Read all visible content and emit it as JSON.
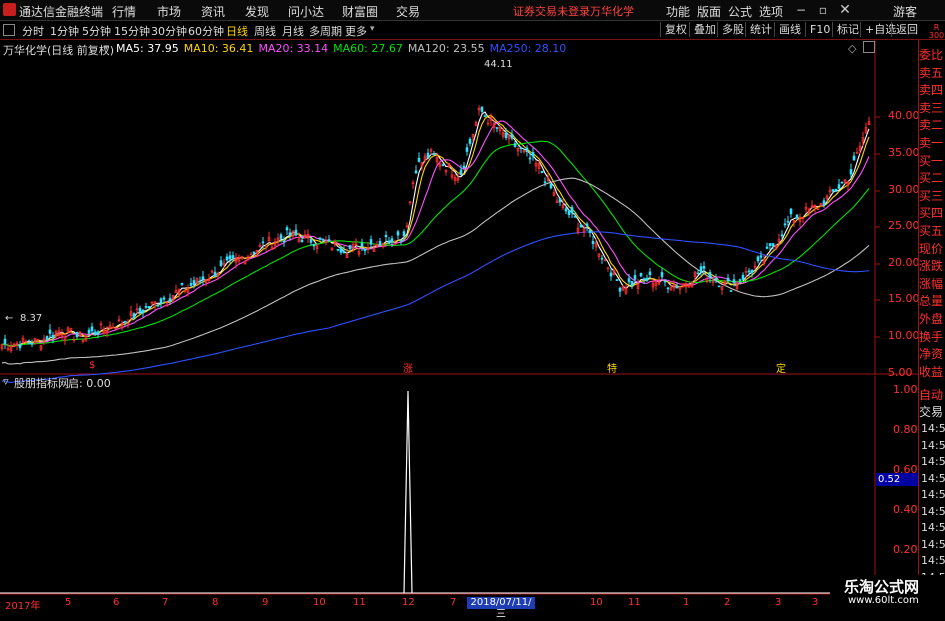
{
  "menubar": {
    "app_title": "通达信金融终端",
    "items": [
      "行情",
      "市场",
      "资讯",
      "发现",
      "问小达",
      "财富圈",
      "交易"
    ],
    "warning": "证券交易未登录",
    "stock": "万华化学",
    "right_items": [
      "功能",
      "版面",
      "公式",
      "选项"
    ],
    "user": "游客"
  },
  "toolbar": {
    "tabs": [
      "分时",
      "1分钟",
      "5分钟",
      "15分钟",
      "30分钟",
      "60分钟",
      "日线",
      "周线",
      "月线",
      "多周期",
      "更多"
    ],
    "active_tab": "日线",
    "right_buttons": [
      "复权",
      "叠加",
      "多股",
      "统计",
      "画线",
      "F10",
      "标记",
      "+自选",
      "返回"
    ]
  },
  "main_chart": {
    "title": "万华化学(日线 前复权)",
    "ma_labels": [
      {
        "text": "MA5: 37.95",
        "color": "#ffffff"
      },
      {
        "text": "MA10: 36.41",
        "color": "#ffd700"
      },
      {
        "text": "MA20: 33.14",
        "color": "#ff4fff"
      },
      {
        "text": "MA60: 27.67",
        "color": "#00e000"
      },
      {
        "text": "MA120: 23.55",
        "color": "#c0c0c0"
      },
      {
        "text": "MA250: 28.10",
        "color": "#3050ff"
      }
    ],
    "high_label": "44.11",
    "low_label": "8.37",
    "y_ticks": [
      "40.00",
      "35.00",
      "30.00",
      "25.00",
      "20.00",
      "15.00",
      "10.00",
      "5.00"
    ],
    "marks": [
      {
        "text": "$",
        "color": "#ff3030"
      },
      {
        "text": "涨",
        "color": "#ff3030"
      },
      {
        "text": "特",
        "color": "#ffd700"
      },
      {
        "text": "定",
        "color": "#ffd700"
      }
    ]
  },
  "side_panel": {
    "top_badge": "R 300",
    "labels": [
      "委比",
      "卖五",
      "卖四",
      "卖三",
      "卖二",
      "卖一",
      "买一",
      "买二",
      "买三",
      "买四",
      "买五",
      "现价",
      "涨跌",
      "涨幅",
      "总量",
      "外盘",
      "换手",
      "净资",
      "收益"
    ],
    "auto_label": "自动",
    "trade_label": "交易",
    "times": [
      "14:56",
      "14:56",
      "14:56",
      "14:56",
      "14:56",
      "14:56",
      "14:56",
      "14:56",
      "14:56",
      "14:56",
      "14:56"
    ]
  },
  "sub_chart": {
    "title": "股朋指标网",
    "value_label": "启: 0.00",
    "y_ticks": [
      "1.00",
      "0.80",
      "0.60",
      "0.40",
      "0.20"
    ],
    "current_value": "0.52"
  },
  "date_axis": {
    "labels": [
      "2017年",
      "5",
      "6",
      "7",
      "8",
      "9",
      "10",
      "11",
      "12",
      "2",
      "3",
      "7",
      "9",
      "10",
      "11",
      "12",
      "1",
      "2",
      "3",
      "4",
      "5",
      "3"
    ],
    "highlight": "2018/07/11/三"
  },
  "watermark": {
    "title": "乐淘公式网",
    "url": "www.60lt.com"
  }
}
